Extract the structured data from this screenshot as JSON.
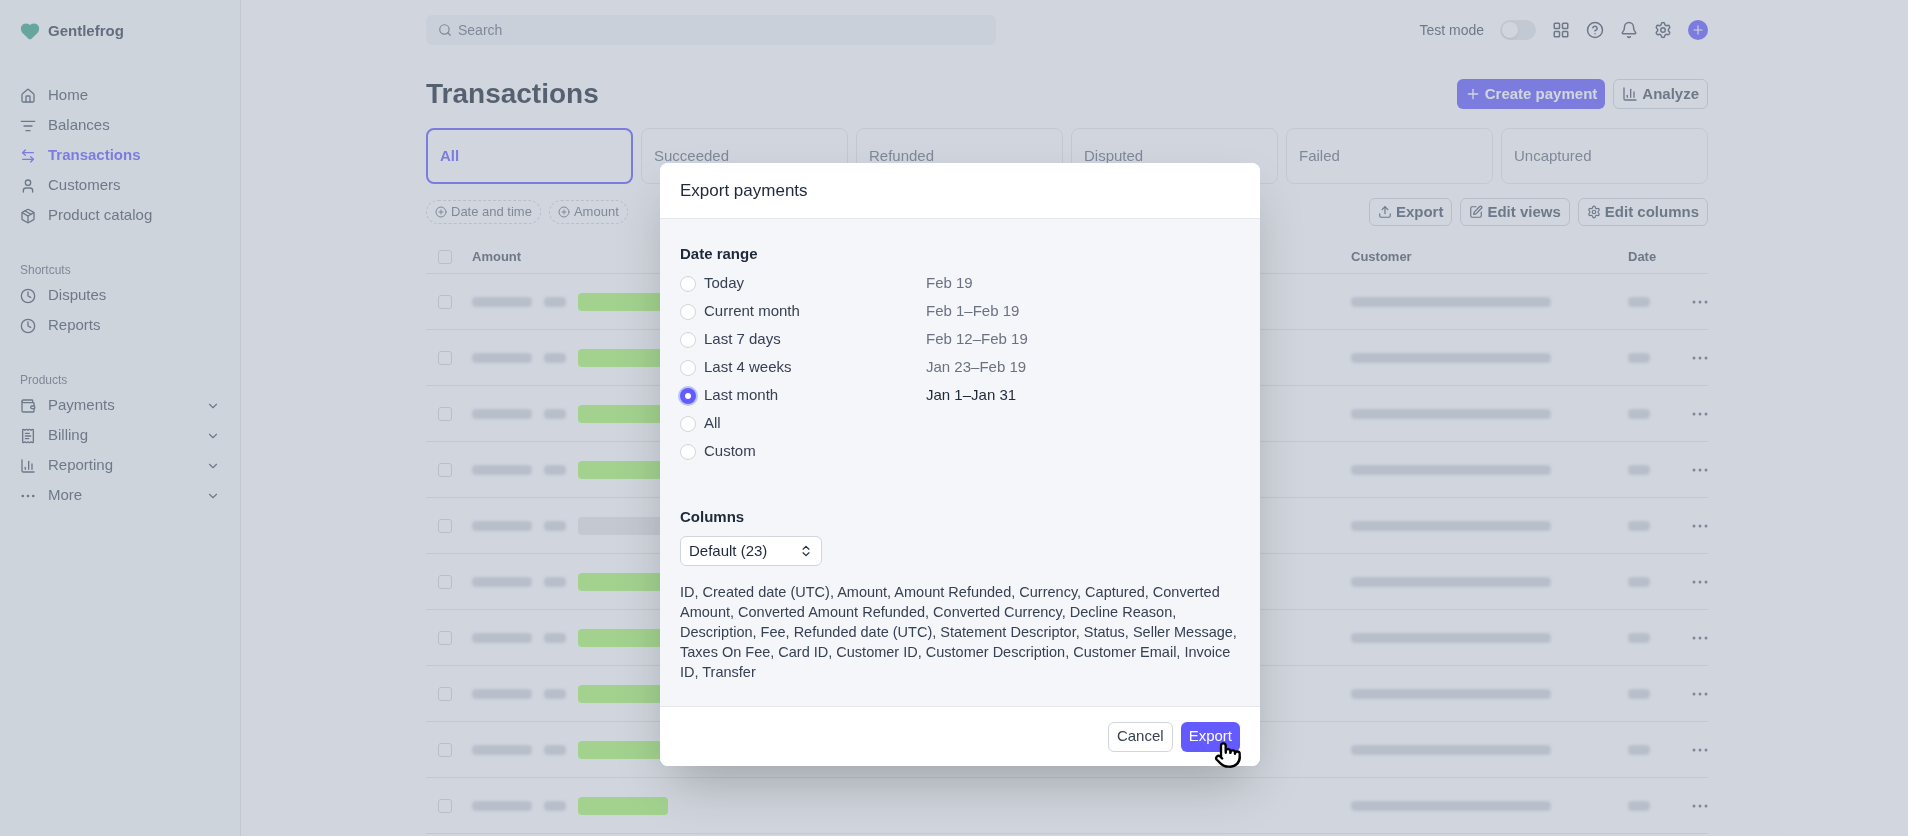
{
  "sidebar": {
    "brand": "Gentlefrog",
    "nav": [
      {
        "label": "Home",
        "selected": false
      },
      {
        "label": "Balances",
        "selected": false
      },
      {
        "label": "Transactions",
        "selected": true
      },
      {
        "label": "Customers",
        "selected": false
      },
      {
        "label": "Product catalog",
        "selected": false
      }
    ],
    "shortcuts": {
      "title": "Shortcuts",
      "items": [
        {
          "label": "Disputes"
        },
        {
          "label": "Reports"
        }
      ]
    },
    "products": {
      "title": "Products",
      "items": [
        {
          "label": "Payments",
          "expanded": false
        },
        {
          "label": "Billing",
          "expanded": false
        },
        {
          "label": "Reporting",
          "expanded": false
        },
        {
          "label": "More",
          "expanded": false
        }
      ]
    }
  },
  "top_bar": {
    "search": {
      "placeholder": "Search"
    },
    "test_mode": {
      "label": "Test mode",
      "on": false
    }
  },
  "page": {
    "title": "Transactions",
    "actions": [
      "Create payment",
      "Analyze"
    ]
  },
  "tabs": [
    {
      "label": "All",
      "selected": true
    },
    {
      "label": "Succeeded",
      "selected": false
    },
    {
      "label": "Refunded",
      "selected": false
    },
    {
      "label": "Disputed",
      "selected": false
    },
    {
      "label": "Failed",
      "selected": false
    },
    {
      "label": "Uncaptured",
      "selected": false
    }
  ],
  "filters": [
    "Date and time",
    "Amount"
  ],
  "table_actions": [
    "Export",
    "Edit views",
    "Edit columns"
  ],
  "table": {
    "columns": [
      "Amount",
      "Customer",
      "Date"
    ],
    "select_all": {
      "checked": false
    },
    "rows": [
      {
        "color": "#a3d28f",
        "checked": false
      },
      {
        "color": "#a3d28f",
        "checked": false
      },
      {
        "color": "#a3d28f",
        "checked": false
      },
      {
        "color": "#a3d28f",
        "checked": false
      },
      {
        "color": "#c4c8d0",
        "checked": false
      },
      {
        "color": "#a3d28f",
        "checked": false
      },
      {
        "color": "#a3d28f",
        "checked": false
      },
      {
        "color": "#a3d28f",
        "checked": false
      },
      {
        "color": "#a3d28f",
        "checked": false
      },
      {
        "color": "#a3d28f",
        "checked": false
      }
    ]
  },
  "dialog": {
    "title": "Export payments",
    "date_range": {
      "label": "Date range",
      "options": [
        {
          "label": "Today",
          "range": "Feb 19",
          "selected": false
        },
        {
          "label": "Current month",
          "range": "Feb 1–Feb 19",
          "selected": false
        },
        {
          "label": "Last 7 days",
          "range": "Feb 12–Feb 19",
          "selected": false
        },
        {
          "label": "Last 4 weeks",
          "range": "Jan 23–Feb 19",
          "selected": false
        },
        {
          "label": "Last month",
          "range": "Jan 1–Jan 31",
          "selected": true
        },
        {
          "label": "All",
          "selected": false
        },
        {
          "label": "Custom",
          "selected": false
        }
      ]
    },
    "columns": {
      "label": "Columns",
      "select": {
        "value": "Default (23)"
      },
      "description": "ID, Created date (UTC), Amount, Amount Refunded, Currency, Captured, Converted Amount, Converted Amount Refunded, Converted Currency, Decline Reason, Description, Fee, Refunded date (UTC), Statement Descriptor, Status, Seller Message, Taxes On Fee, Card ID, Customer ID, Customer Description, Customer Email, Invoice ID, Transfer"
    },
    "buttons": [
      {
        "label": "Cancel",
        "kind": "secondary"
      },
      {
        "label": "Export",
        "kind": "primary"
      }
    ]
  }
}
